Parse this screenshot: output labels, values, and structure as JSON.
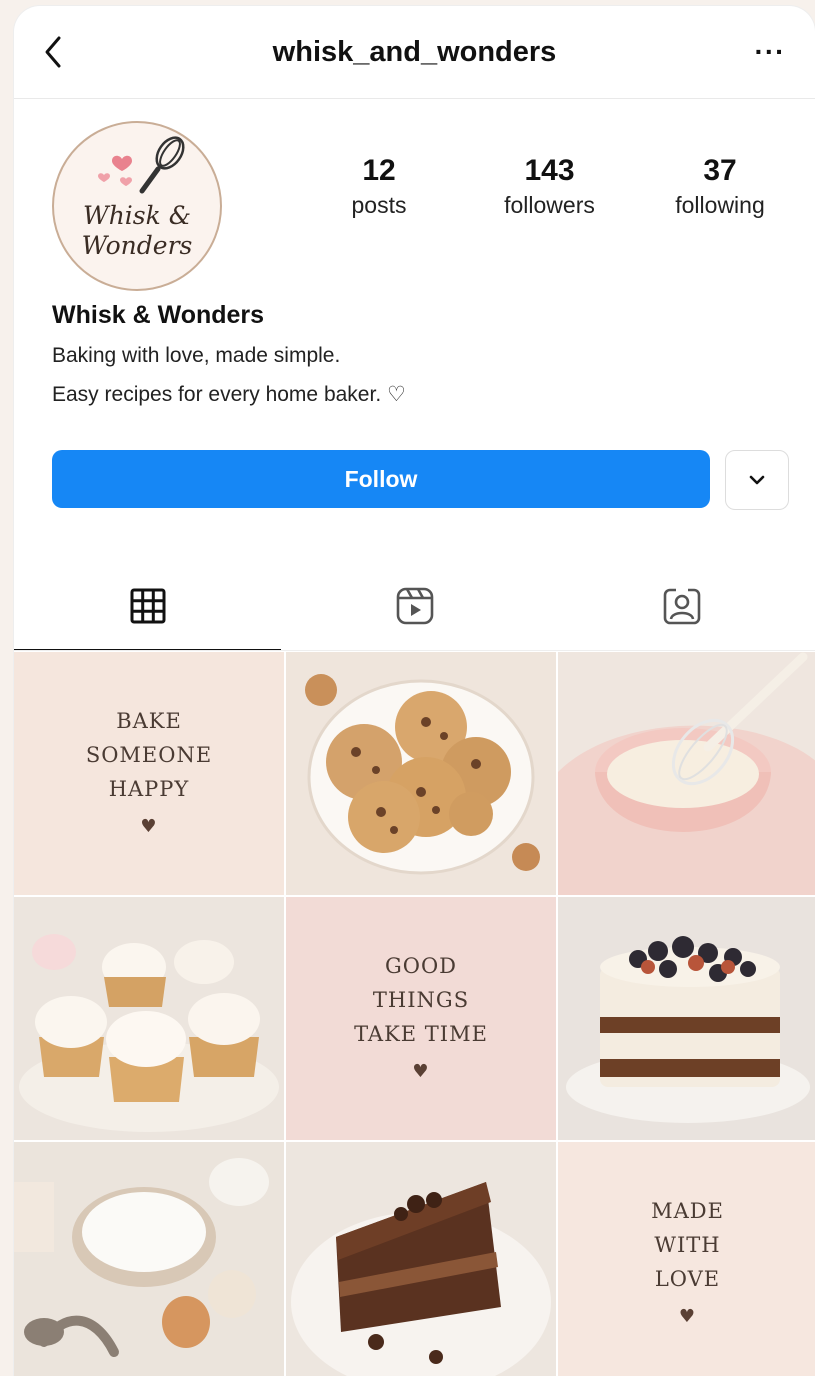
{
  "header": {
    "username": "whisk_and_wonders",
    "more_label": "···"
  },
  "avatar": {
    "line1": "Whisk &",
    "line2": "Wonders"
  },
  "stats": [
    {
      "value": "12",
      "label": "posts"
    },
    {
      "value": "143",
      "label": "followers"
    },
    {
      "value": "37",
      "label": "following"
    }
  ],
  "bio": {
    "name": "Whisk & Wonders",
    "line1": "Baking with love, made simple.",
    "line2": "Easy recipes for every home baker. ♡"
  },
  "actions": {
    "follow_label": "Follow"
  },
  "tabs": [
    {
      "name": "grid",
      "icon": "grid-icon",
      "active": true
    },
    {
      "name": "reels",
      "icon": "reels-icon",
      "active": false
    },
    {
      "name": "tagged",
      "icon": "tagged-icon",
      "active": false
    }
  ],
  "posts": {
    "quote1": {
      "l1": "BAKE",
      "l2": "SOMEONE",
      "l3": "HAPPY",
      "heart": "♥"
    },
    "quote2": {
      "l1": "GOOD",
      "l2": "THINGS",
      "l3": "TAKE TIME",
      "heart": "♥"
    },
    "quote3": {
      "l1": "MADE",
      "l2": "WITH",
      "l3": "LOVE",
      "heart": "♥"
    }
  },
  "colors": {
    "follow_button": "#1687f5",
    "quote_bg_1": "#f5e6dd",
    "quote_bg_2": "#f2dbd6",
    "quote_bg_3": "#f6e7df"
  }
}
